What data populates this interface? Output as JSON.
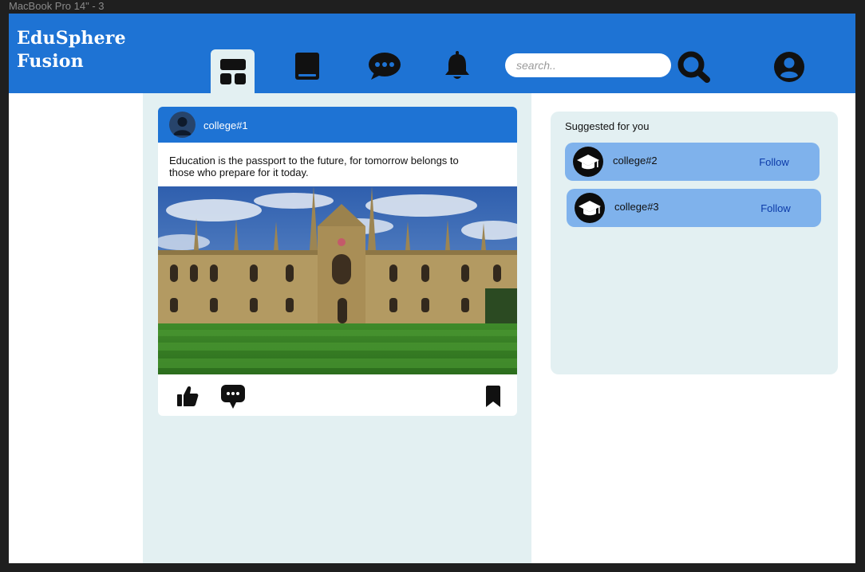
{
  "window": {
    "frame_label": "MacBook Pro 14\" - 3"
  },
  "header": {
    "logo_line1": "EduSphere",
    "logo_line2": "Fusion",
    "nav": [
      {
        "icon": "dashboard-icon",
        "active": true
      },
      {
        "icon": "book-icon"
      },
      {
        "icon": "chat-bubble-icon"
      },
      {
        "icon": "bell-icon"
      }
    ],
    "search": {
      "placeholder": "search..",
      "value": ""
    },
    "search_icon": "search-icon",
    "profile_icon": "user-circle-icon"
  },
  "feed": {
    "post": {
      "author": "college#1",
      "text": "Education is the passport to the future, for tomorrow belongs to those who prepare for it today.",
      "image": "college-building-photo",
      "actions": [
        "thumbs-up-icon",
        "comment-icon",
        "bookmark-icon"
      ]
    }
  },
  "suggestions": {
    "title": "Suggested for you",
    "items": [
      {
        "name": "college#2",
        "follow_label": "Follow",
        "icon": "graduation-cap-icon"
      },
      {
        "name": "college#3",
        "follow_label": "Follow",
        "icon": "graduation-cap-icon"
      }
    ]
  },
  "colors": {
    "header": "#1e73d4",
    "panel": "#e3f0f2",
    "card": "#7fb2ec",
    "follow_text": "#0b3aa8"
  }
}
